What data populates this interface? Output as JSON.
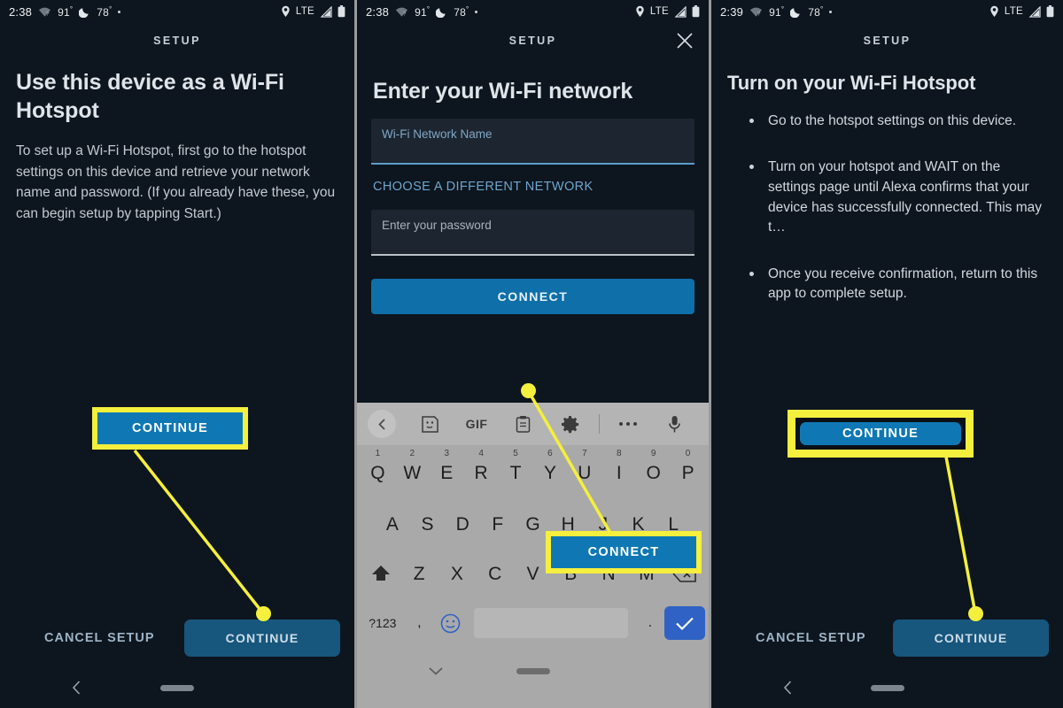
{
  "meta": {
    "panel_count": 3,
    "accent_blue": "#0f78b4",
    "button_blue": "#17567d",
    "highlight_yellow": "#f5ef3d",
    "background": "#0d151e"
  },
  "panels": [
    {
      "id": "panel-1",
      "status": {
        "time": "2:38",
        "temp_high": "91",
        "temp_low": "78",
        "degree": "°",
        "network": "LTE",
        "icons": [
          "wifi-question-icon",
          "moon-icon",
          "dot-icon",
          "location-pin-icon",
          "signal-icon",
          "battery-icon"
        ]
      },
      "header": {
        "title": "SETUP",
        "has_close": false
      },
      "heading": "Use this device as a Wi-Fi Hotspot",
      "body": "To set up a Wi-Fi Hotspot, first go to the hotspot settings on this device and retrieve your network name and password. (If you already have these, you can begin setup by tapping Start.)",
      "callout": {
        "label": "CONTINUE",
        "style": "square"
      },
      "bottom": {
        "cancel": "CANCEL SETUP",
        "primary": "CONTINUE"
      },
      "nav": [
        "back-chevron-icon",
        "home-pill-icon"
      ]
    },
    {
      "id": "panel-2",
      "status": {
        "time": "2:38",
        "temp_high": "91",
        "temp_low": "78",
        "degree": "°",
        "network": "LTE",
        "icons": [
          "wifi-question-icon",
          "moon-icon",
          "dot-icon",
          "location-pin-icon",
          "signal-icon",
          "battery-icon"
        ]
      },
      "header": {
        "title": "SETUP",
        "has_close": true
      },
      "heading": "Enter your Wi-Fi network",
      "form": {
        "network_placeholder": "Wi-Fi Network Name",
        "network_value": "",
        "alt_network_link": "CHOOSE A DIFFERENT NETWORK",
        "password_placeholder": "Enter your password",
        "password_value": "",
        "submit_label": "CONNECT"
      },
      "callout": {
        "label": "CONNECT",
        "style": "square"
      },
      "keyboard": {
        "toolbar": [
          "back-chevron-icon",
          "sticker-icon",
          "GIF",
          "clipboard-icon",
          "gear-icon",
          "overflow-dots-icon",
          "microphone-icon"
        ],
        "gif_label": "GIF",
        "row1": [
          "Q",
          "W",
          "E",
          "R",
          "T",
          "Y",
          "U",
          "I",
          "O",
          "P"
        ],
        "row1_numbers": [
          "1",
          "2",
          "3",
          "4",
          "5",
          "6",
          "7",
          "8",
          "9",
          "0"
        ],
        "row2": [
          "A",
          "S",
          "D",
          "F",
          "G",
          "H",
          "J",
          "K",
          "L"
        ],
        "row3": [
          "Z",
          "X",
          "C",
          "V",
          "B",
          "N",
          "M"
        ],
        "shift": "shift-icon",
        "backspace": "backspace-icon",
        "numeric_label": "?123",
        "comma": ",",
        "period": ".",
        "emoji": "emoji-icon",
        "enter": "check-icon"
      },
      "nav": [
        "chevron-down-icon",
        "home-pill-icon"
      ]
    },
    {
      "id": "panel-3",
      "status": {
        "time": "2:39",
        "temp_high": "91",
        "temp_low": "78",
        "degree": "°",
        "network": "LTE",
        "icons": [
          "wifi-question-icon",
          "moon-icon",
          "dot-icon",
          "location-pin-icon",
          "signal-icon",
          "battery-icon"
        ]
      },
      "header": {
        "title": "SETUP",
        "has_close": false
      },
      "heading": "Turn on your Wi-Fi Hotspot",
      "bullets": [
        "Go to the hotspot settings on this device.",
        "Turn on your hotspot and WAIT on the settings page until Alexa confirms that your device has successfully connected. This may t…",
        "Once you receive confirmation, return to this app to complete setup."
      ],
      "callout": {
        "label": "CONTINUE",
        "style": "rounded"
      },
      "bottom": {
        "cancel": "CANCEL SETUP",
        "primary": "CONTINUE"
      },
      "nav": [
        "back-chevron-icon",
        "home-pill-icon"
      ]
    }
  ]
}
